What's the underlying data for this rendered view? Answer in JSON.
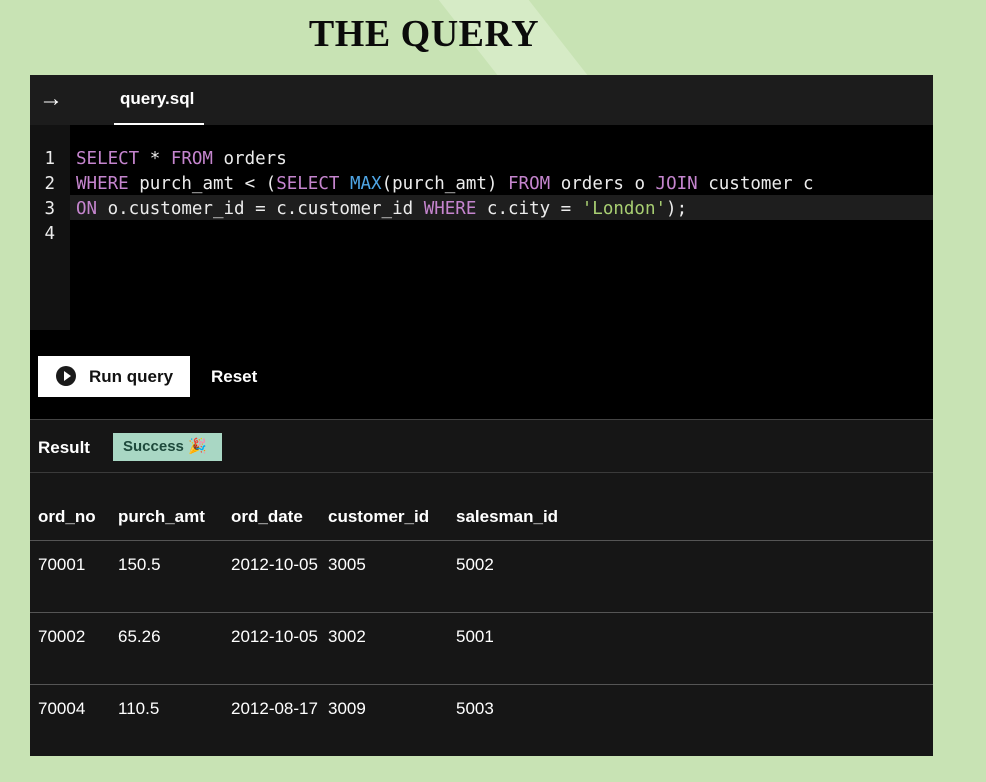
{
  "page_title": "THE QUERY",
  "editor": {
    "tab_label": "query.sql",
    "lines": [
      {
        "num": "1",
        "tokens": [
          {
            "t": "SELECT",
            "c": "kw"
          },
          {
            "t": " * ",
            "c": ""
          },
          {
            "t": "FROM",
            "c": "kw"
          },
          {
            "t": " orders",
            "c": ""
          }
        ]
      },
      {
        "num": "2",
        "tokens": [
          {
            "t": "WHERE",
            "c": "kw"
          },
          {
            "t": " purch_amt < (",
            "c": ""
          },
          {
            "t": "SELECT",
            "c": "kw"
          },
          {
            "t": " ",
            "c": ""
          },
          {
            "t": "MAX",
            "c": "fn"
          },
          {
            "t": "(purch_amt) ",
            "c": ""
          },
          {
            "t": "FROM",
            "c": "kw"
          },
          {
            "t": " orders o ",
            "c": ""
          },
          {
            "t": "JOIN",
            "c": "kw"
          },
          {
            "t": " customer c",
            "c": ""
          }
        ]
      },
      {
        "num": "3",
        "tokens": [
          {
            "t": "ON",
            "c": "kw"
          },
          {
            "t": " o.customer_id = c.customer_id ",
            "c": ""
          },
          {
            "t": "WHERE",
            "c": "kw"
          },
          {
            "t": " c.city = ",
            "c": ""
          },
          {
            "t": "'London'",
            "c": "str"
          },
          {
            "t": ");",
            "c": ""
          }
        ]
      },
      {
        "num": "4",
        "tokens": []
      }
    ]
  },
  "actions": {
    "run_label": "Run query",
    "reset_label": "Reset"
  },
  "result": {
    "label": "Result",
    "status": "Success 🎉",
    "columns": [
      "ord_no",
      "purch_amt",
      "ord_date",
      "customer_id",
      "salesman_id"
    ],
    "rows": [
      [
        "70001",
        "150.5",
        "2012-10-05",
        "3005",
        "5002"
      ],
      [
        "70002",
        "65.26",
        "2012-10-05",
        "3002",
        "5001"
      ],
      [
        "70004",
        "110.5",
        "2012-08-17",
        "3009",
        "5003"
      ]
    ]
  },
  "colors": {
    "background": "#c8e3b4",
    "keyword": "#c585ce",
    "function": "#4fa6e6",
    "string": "#a8cf72",
    "badge": "#a9d7c4"
  },
  "icons": {
    "back": "arrow-right-icon",
    "run": "play-circle-icon"
  }
}
